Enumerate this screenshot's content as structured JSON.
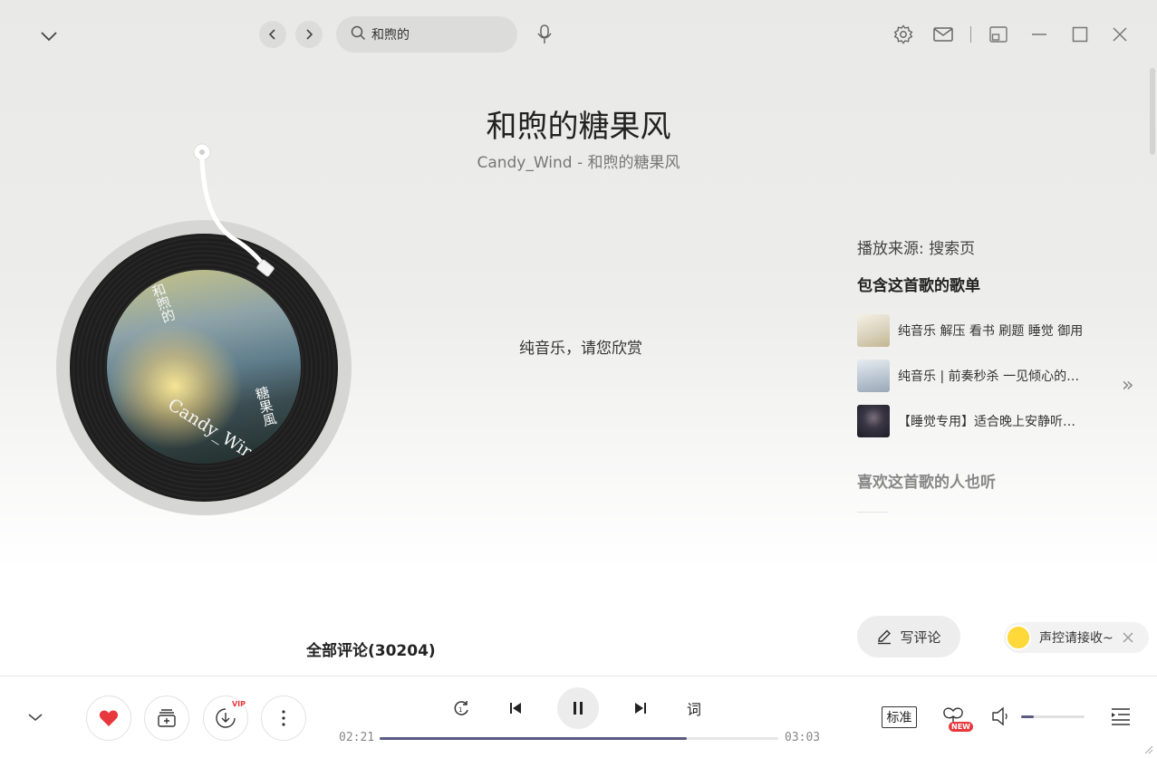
{
  "search": {
    "value": "和煦的"
  },
  "song": {
    "title": "和煦的糖果风",
    "subtitle": "Candy_Wind - 和煦的糖果风",
    "lyric": "纯音乐，请您欣赏",
    "cover_artist": "Candy_Wind",
    "cover_title_left": "和煦的",
    "cover_title_right": "糖果風"
  },
  "side": {
    "source": "播放来源: 搜索页",
    "playlists_heading": "包含这首歌的歌单",
    "playlists": [
      {
        "name": "纯音乐 解压 看书 刷题 睡觉 御用",
        "thumb_color": "#d8d2c0"
      },
      {
        "name": "纯音乐 | 前奏秒杀 一见倾心的…",
        "thumb_color": "#b8c2cc"
      },
      {
        "name": "【睡觉专用】适合晚上安静听…",
        "thumb_color": "#2e2f3a"
      }
    ],
    "similar_heading": "喜欢这首歌的人也听"
  },
  "comments": {
    "write_label": "写评论",
    "heading": "全部评论(30204)"
  },
  "voice": {
    "label": "声控请接收~"
  },
  "player": {
    "elapsed": "02:21",
    "duration": "03:03",
    "progress": 0.77,
    "quality": "标准",
    "lyric_btn": "词",
    "vip_tag": "VIP",
    "new_tag": "NEW",
    "volume": 0.2,
    "accent": "#5a5a82",
    "like_color": "#e8383d"
  }
}
